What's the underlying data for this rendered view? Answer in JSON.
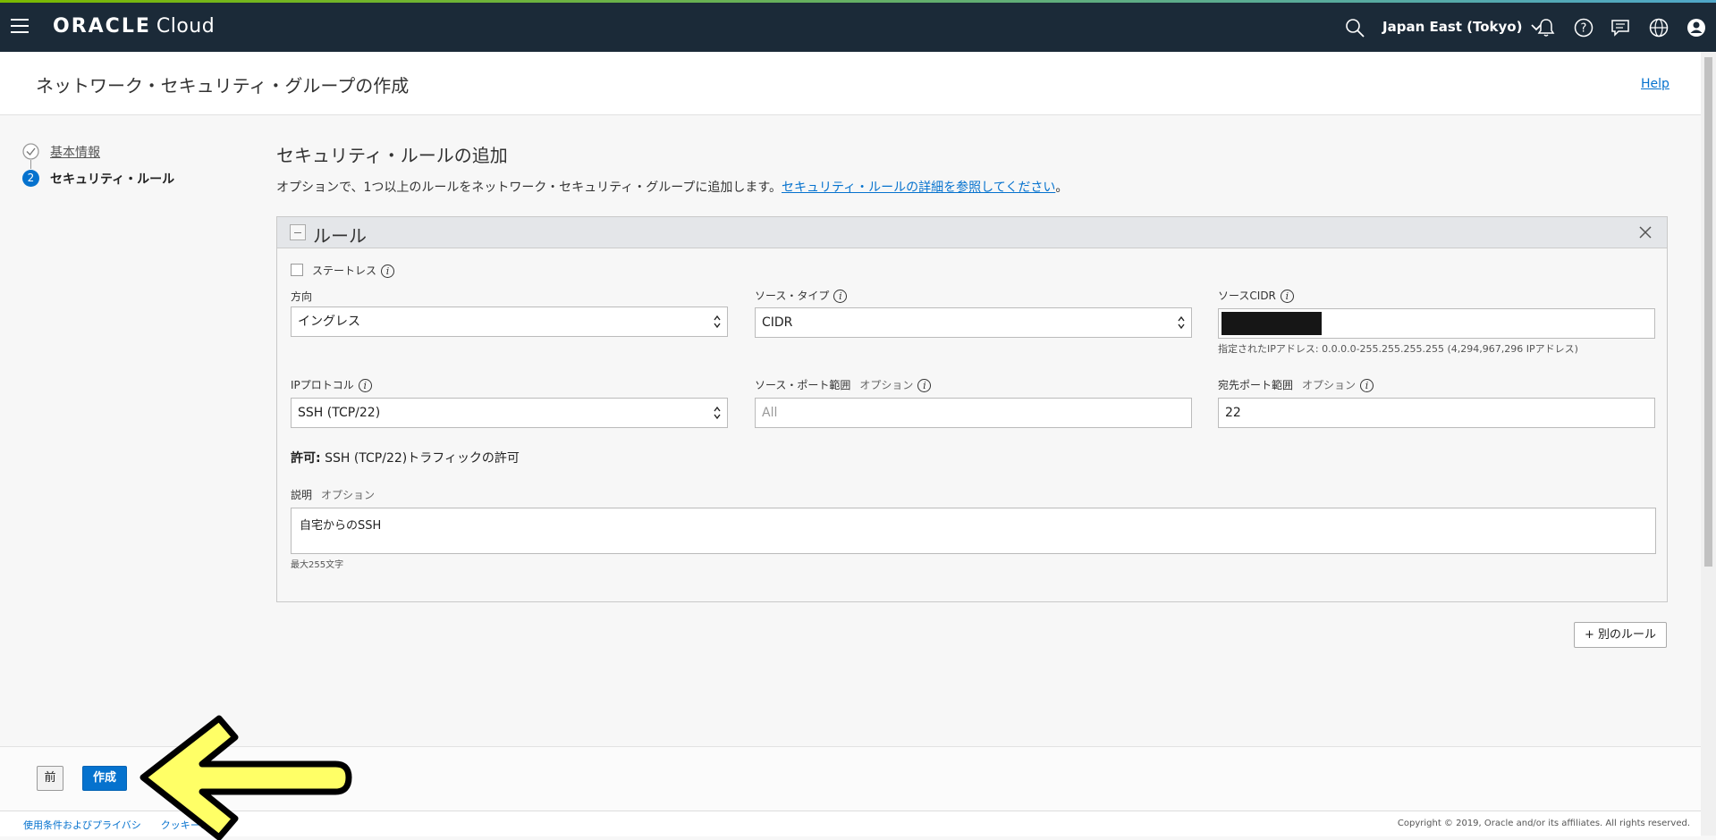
{
  "topbar": {
    "brand_main": "ORACLE",
    "brand_sub": "Cloud",
    "region": "Japan East (Tokyo)"
  },
  "header": {
    "title": "ネットワーク・セキュリティ・グループの作成",
    "help": "Help"
  },
  "steps": [
    {
      "number": "1",
      "label": "基本情報",
      "status": "complete"
    },
    {
      "number": "2",
      "label": "セキュリティ・ルール",
      "status": "current"
    }
  ],
  "main": {
    "heading": "セキュリティ・ルールの追加",
    "description": "オプションで、1つ以上のルールをネットワーク・セキュリティ・グループに追加します。",
    "description_link": "セキュリティ・ルールの詳細を参照してください",
    "description_end": "。"
  },
  "rule": {
    "title": "ルール",
    "stateless_label": "ステートレス",
    "stateless_checked": false,
    "direction_label": "方向",
    "direction_value": "イングレス",
    "source_type_label": "ソース・タイプ",
    "source_type_value": "CIDR",
    "source_cidr_label": "ソースCIDR",
    "source_cidr_hint": "指定されたIPアドレス: 0.0.0.0-255.255.255.255 (4,294,967,296 IPアドレス)",
    "ip_protocol_label": "IPプロトコル",
    "ip_protocol_value": "SSH (TCP/22)",
    "source_port_label": "ソース・ポート範囲",
    "source_port_optional": "オプション",
    "source_port_placeholder": "All",
    "dest_port_label": "宛先ポート範囲",
    "dest_port_optional": "オプション",
    "dest_port_value": "22",
    "allow_prefix": "許可:",
    "allow_text": "SSH (TCP/22)トラフィックの許可",
    "description_label": "説明",
    "description_optional": "オプション",
    "description_value": "自宅からのSSH",
    "description_hint": "最大255文字"
  },
  "add_rule_button": "+ 別のルール",
  "buttons": {
    "prev": "前",
    "create": "作成"
  },
  "footer": {
    "terms": "使用条件およびプライバシ",
    "cookie": "クッキーの詳細",
    "copyright": "Copyright © 2019, Oracle and/or its affiliates. All rights reserved."
  },
  "colors": {
    "topbar": "#1b2a38",
    "primary": "#0572ce",
    "annotation_arrow": "#ffff66"
  }
}
